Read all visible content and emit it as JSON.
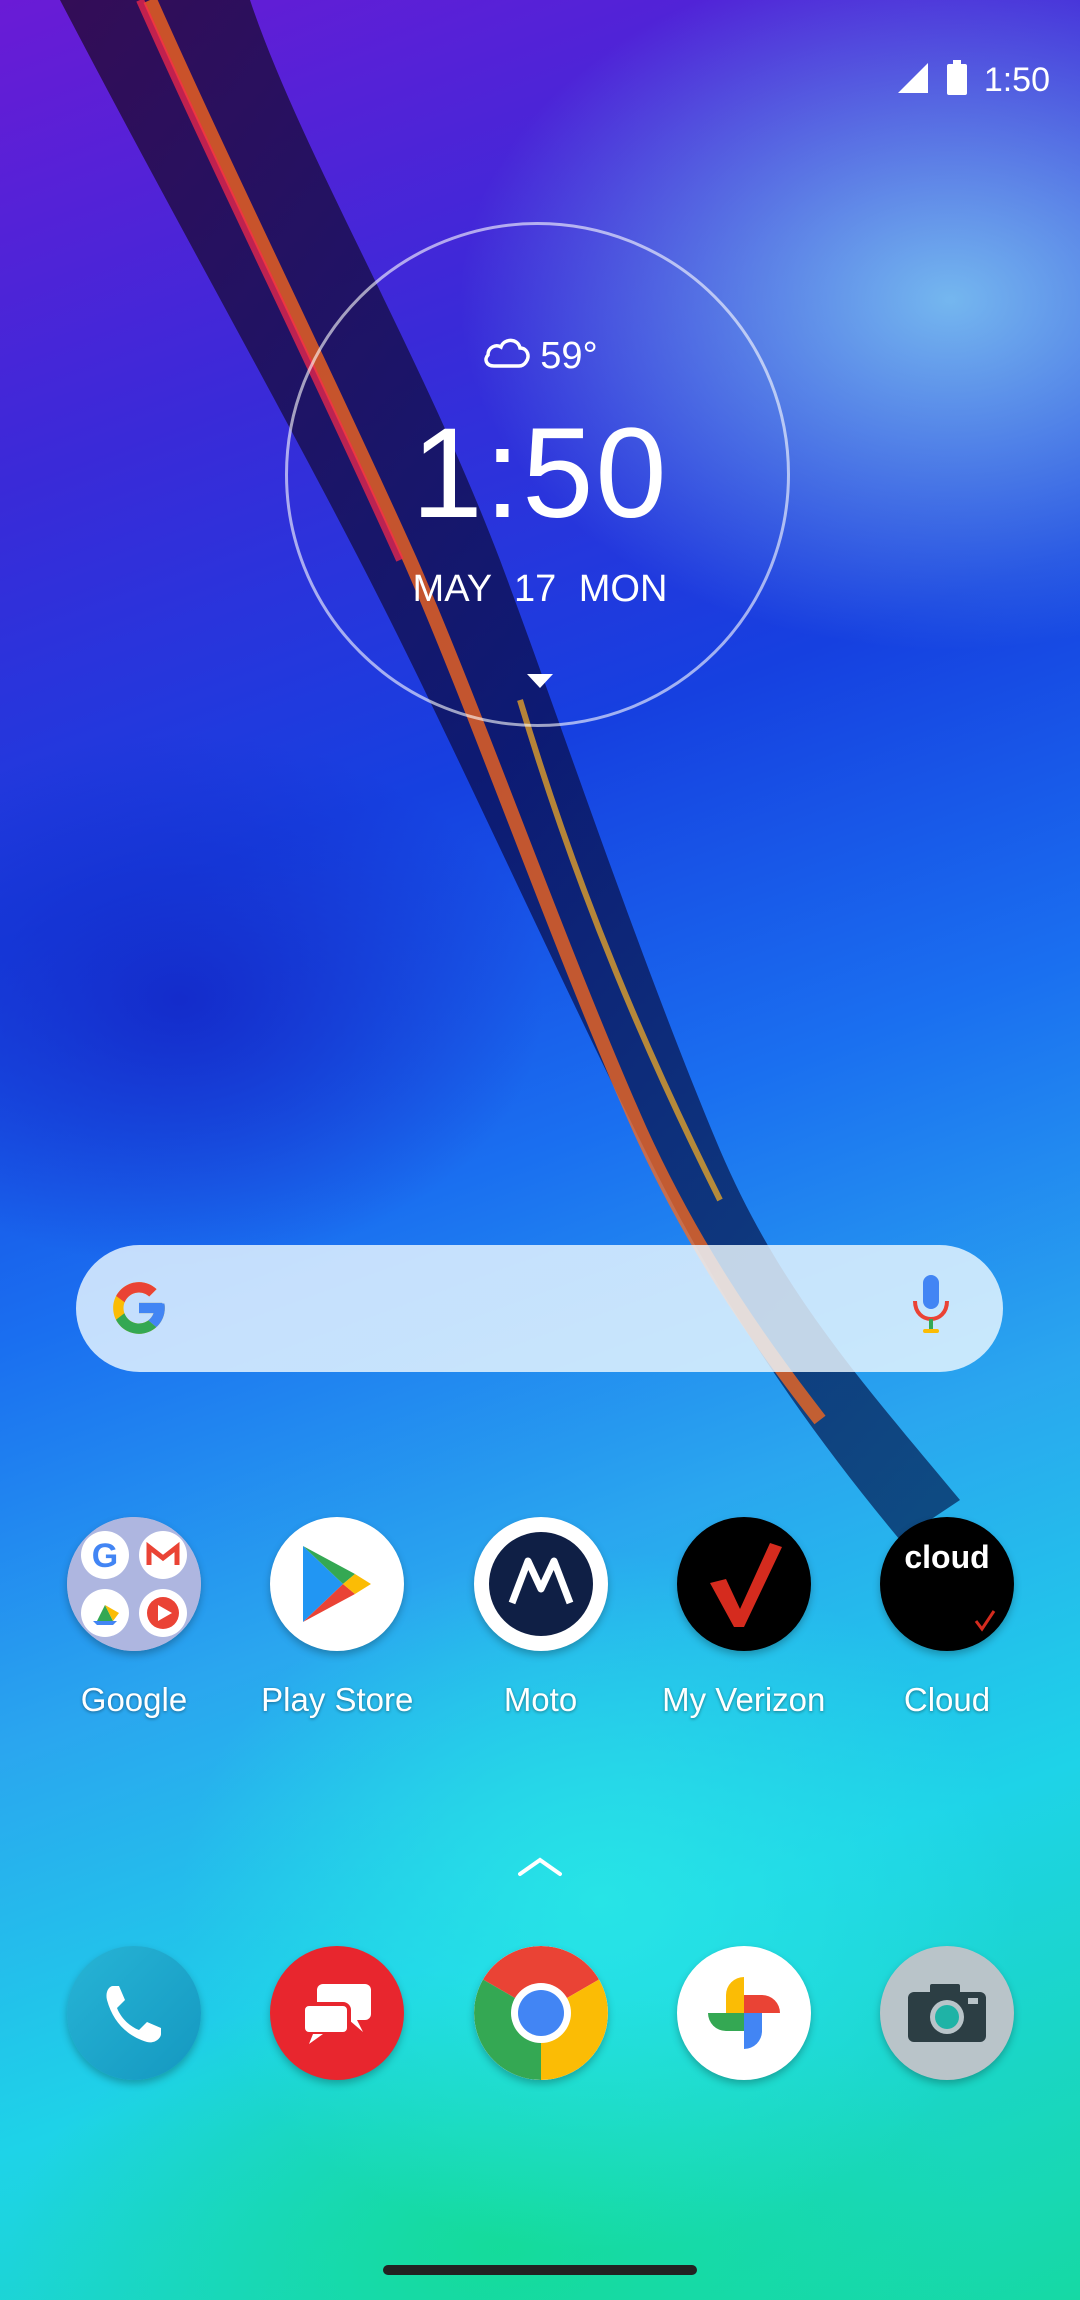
{
  "status_bar": {
    "time": "1:50",
    "signal_icon": "signal-icon",
    "battery_icon": "battery-icon"
  },
  "clock_widget": {
    "weather_icon": "cloud-icon",
    "temperature": "59°",
    "time": "1:50",
    "date": "MAY  17  MON",
    "expand_icon": "caret-down-icon"
  },
  "search_bar": {
    "logo_icon": "google-g-icon",
    "mic_icon": "mic-icon"
  },
  "apps": [
    {
      "label": "Google",
      "icon": "google-folder-icon"
    },
    {
      "label": "Play Store",
      "icon": "play-store-icon"
    },
    {
      "label": "Moto",
      "icon": "moto-icon"
    },
    {
      "label": "My Verizon",
      "icon": "verizon-icon"
    },
    {
      "label": "Cloud",
      "icon": "cloud-app-icon",
      "icon_text": "cloud"
    }
  ],
  "dock": [
    {
      "icon": "phone-icon"
    },
    {
      "icon": "messages-icon"
    },
    {
      "icon": "chrome-icon"
    },
    {
      "icon": "photos-icon"
    },
    {
      "icon": "camera-icon"
    }
  ],
  "colors": {
    "google_blue": "#4285F4",
    "google_red": "#EA4335",
    "google_yellow": "#FBBC05",
    "google_green": "#34A853",
    "verizon_red": "#D52B1E"
  }
}
